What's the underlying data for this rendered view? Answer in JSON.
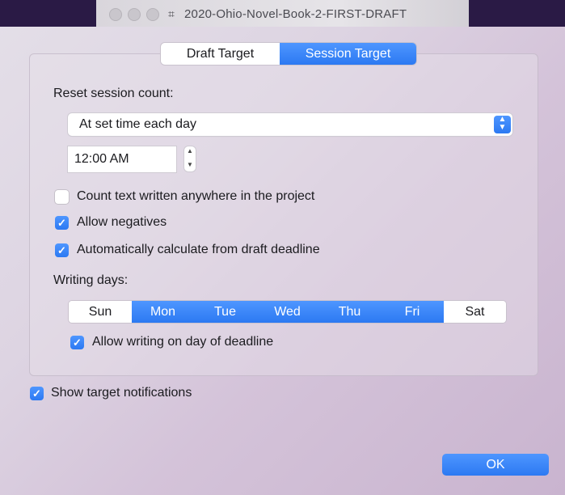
{
  "window": {
    "title": "2020-Ohio-Novel-Book-2-FIRST-DRAFT",
    "title_icon": "document-icon"
  },
  "tabs": [
    {
      "label": "Draft Target",
      "selected": false
    },
    {
      "label": "Session Target",
      "selected": true
    }
  ],
  "reset": {
    "label": "Reset session count:",
    "select_value": "At set time each day",
    "time_value": "12:00 AM"
  },
  "options": {
    "count_anywhere": {
      "label": "Count text written anywhere in the project",
      "checked": false
    },
    "allow_negatives": {
      "label": "Allow negatives",
      "checked": true
    },
    "auto_calc": {
      "label": "Automatically calculate from draft deadline",
      "checked": true
    }
  },
  "writing_days": {
    "label": "Writing days:",
    "days": [
      {
        "label": "Sun",
        "selected": false
      },
      {
        "label": "Mon",
        "selected": true
      },
      {
        "label": "Tue",
        "selected": true
      },
      {
        "label": "Wed",
        "selected": true
      },
      {
        "label": "Thu",
        "selected": true
      },
      {
        "label": "Fri",
        "selected": true
      },
      {
        "label": "Sat",
        "selected": false
      }
    ],
    "deadline_day": {
      "label": "Allow writing on day of deadline",
      "checked": true
    }
  },
  "notifications": {
    "label": "Show target notifications",
    "checked": true
  },
  "ok_label": "OK",
  "colors": {
    "accent": "#2f7df4"
  }
}
